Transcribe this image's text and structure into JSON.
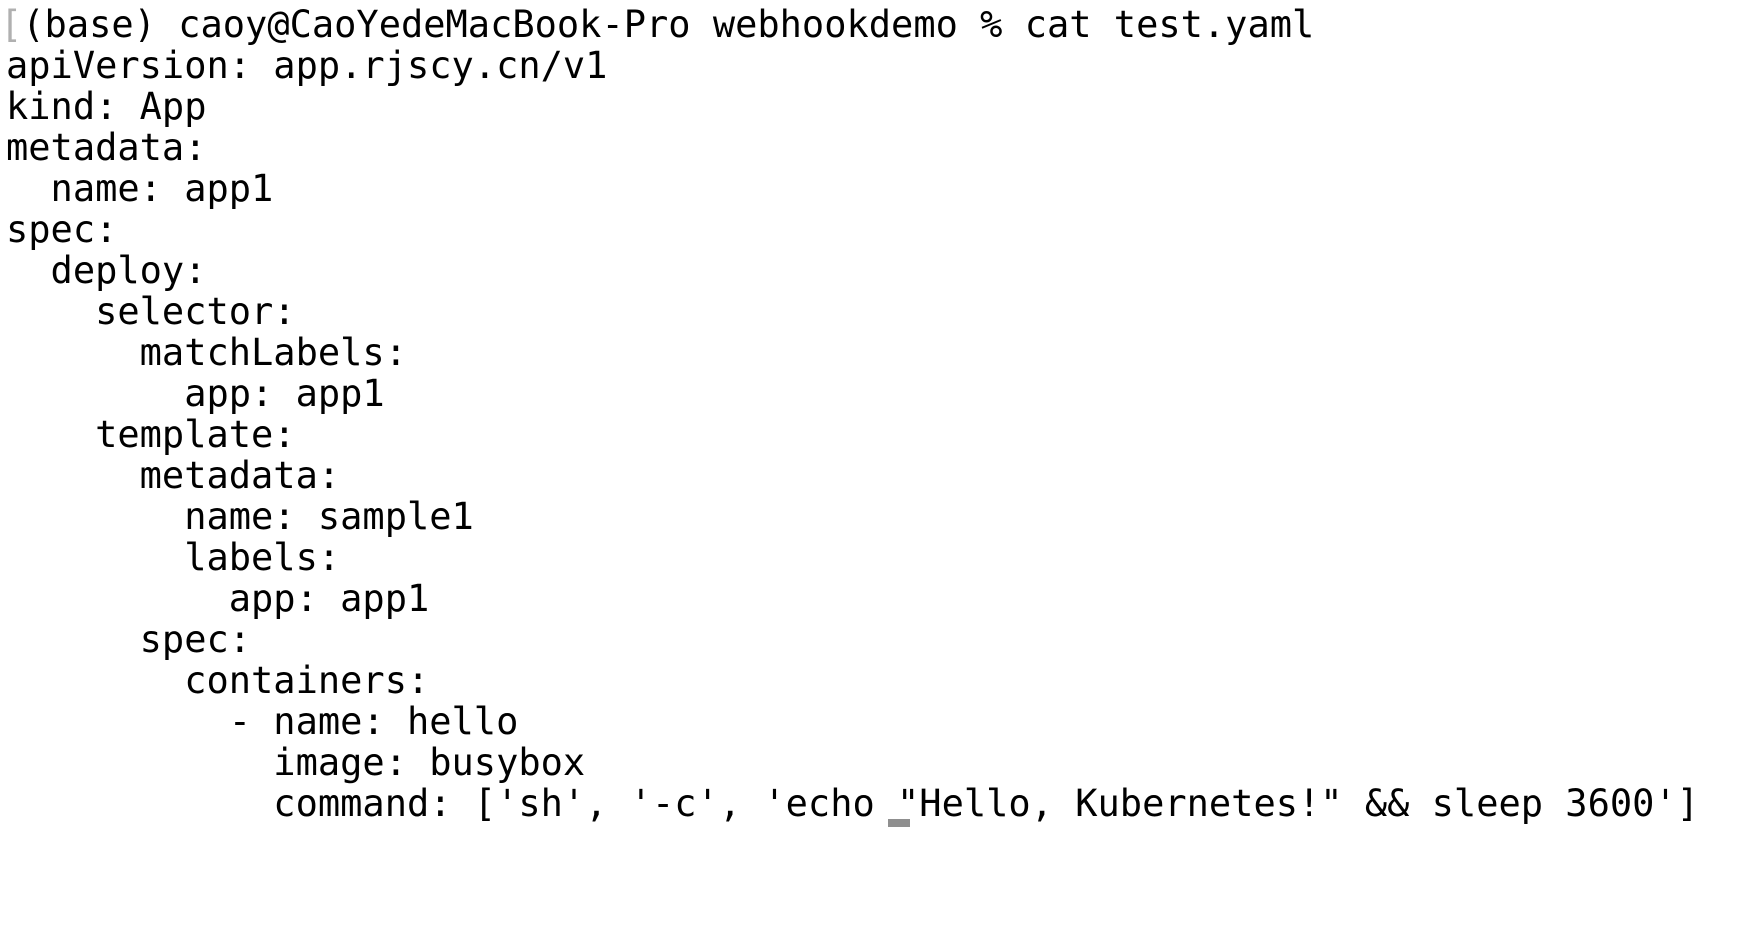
{
  "terminal": {
    "prompt_marker": "[",
    "prompt": "(base) caoy@CaoYedeMacBook-Pro webhookdemo % ",
    "command": "cat test.yaml",
    "output_lines": [
      "apiVersion: app.rjscy.cn/v1",
      "kind: App",
      "metadata:",
      "  name: app1",
      "spec:",
      "  deploy:",
      "    selector:",
      "      matchLabels:",
      "        app: app1",
      "    template:",
      "      metadata:",
      "        name: sample1",
      "        labels:",
      "          app: app1",
      "      spec:",
      "        containers:",
      "          - name: hello",
      "            image: busybox",
      "            command: ['sh', '-c', 'echo \"Hello, Kubernetes!\" && sleep 3600']"
    ],
    "colors": {
      "background": "#ffffff",
      "text": "#000000",
      "cursor": "#8f8f8f"
    }
  }
}
